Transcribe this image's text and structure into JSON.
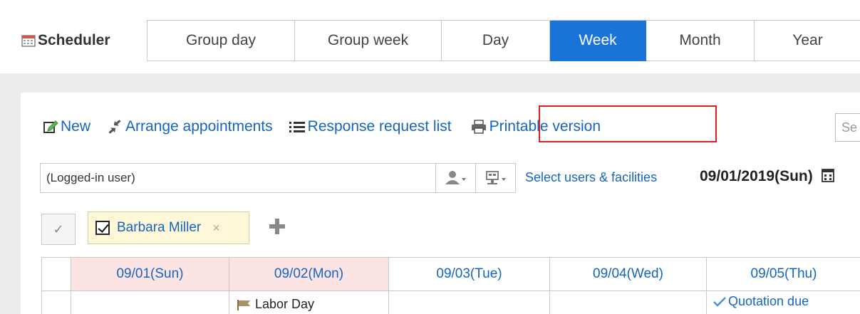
{
  "app": {
    "title": "Scheduler",
    "icon": "calendar-icon"
  },
  "tabs": [
    {
      "label": "Group day",
      "active": false
    },
    {
      "label": "Group week",
      "active": false
    },
    {
      "label": "Day",
      "active": false
    },
    {
      "label": "Week",
      "active": true
    },
    {
      "label": "Month",
      "active": false
    },
    {
      "label": "Year",
      "active": false
    }
  ],
  "toolbar": {
    "new_label": "New",
    "arrange_label": "Arrange appointments",
    "response_label": "Response request list",
    "print_label": "Printable version",
    "search_placeholder": "Se"
  },
  "user_row": {
    "selected_user": "(Logged-in user)",
    "select_link": "Select users & facilities",
    "date": "09/01/2019(Sun)"
  },
  "chip": {
    "name": "Barbara Miller",
    "remove": "×"
  },
  "calendar": {
    "days": [
      {
        "label": "09/01(Sun)",
        "holiday": true,
        "event": "",
        "event_type": ""
      },
      {
        "label": "09/02(Mon)",
        "holiday": true,
        "event": "Labor Day",
        "event_type": "holiday"
      },
      {
        "label": "09/03(Tue)",
        "holiday": false,
        "event": "",
        "event_type": ""
      },
      {
        "label": "09/04(Wed)",
        "holiday": false,
        "event": "",
        "event_type": ""
      },
      {
        "label": "09/05(Thu)",
        "holiday": false,
        "event": "Quotation due",
        "event_type": "task"
      }
    ]
  },
  "colors": {
    "accent": "#1a73d9",
    "link": "#1565c0",
    "holiday_bg": "#fde4e4",
    "highlight_box": "#e02020",
    "chip_bg": "#fff8d8"
  }
}
